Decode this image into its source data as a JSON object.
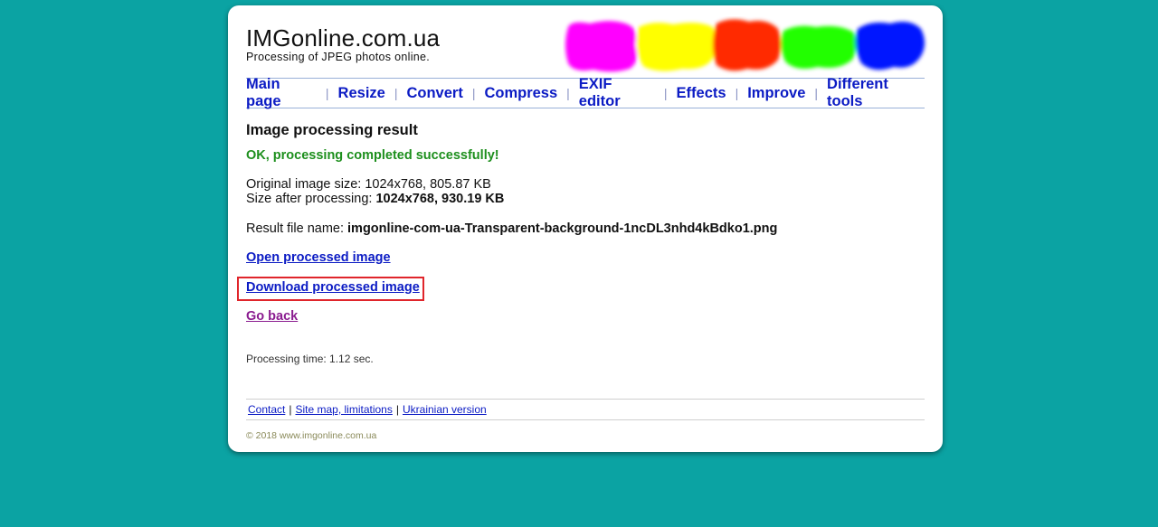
{
  "header": {
    "site_title": "IMGonline.com.ua",
    "tagline": "Processing of JPEG photos online.",
    "paint_colors": [
      "#ff00ff",
      "#ffff00",
      "#ff2a00",
      "#22ff00",
      "#0015ff"
    ]
  },
  "nav": {
    "items": [
      {
        "label": "Main page"
      },
      {
        "label": "Resize"
      },
      {
        "label": "Convert"
      },
      {
        "label": "Compress"
      },
      {
        "label": "EXIF editor"
      },
      {
        "label": "Effects"
      },
      {
        "label": "Improve"
      },
      {
        "label": "Different tools"
      }
    ],
    "separator": "|"
  },
  "result": {
    "heading": "Image processing result",
    "status": "OK, processing completed successfully!",
    "original_label": "Original image size:",
    "original_value": "1024x768, 805.87 KB",
    "after_label": "Size after processing:",
    "after_value": "1024x768, 930.19 KB",
    "filename_label": "Result file name:",
    "filename_value": "imgonline-com-ua-Transparent-background-1ncDL3nhd4kBdko1.png"
  },
  "links": {
    "open": "Open processed image",
    "download": "Download processed image",
    "back": "Go back"
  },
  "processing_time": "Processing time: 1.12 sec.",
  "footer": {
    "contact": "Contact",
    "sitemap": "Site map, limitations",
    "ukrainian": "Ukrainian version",
    "separator": "|",
    "copyright": "© 2018 www.imgonline.com.ua"
  },
  "colors": {
    "background": "#0ba3a3",
    "link": "#0b1bc4",
    "visited_link": "#8a1b8f",
    "success": "#1d8f1d",
    "highlight_box": "#e0252b"
  }
}
